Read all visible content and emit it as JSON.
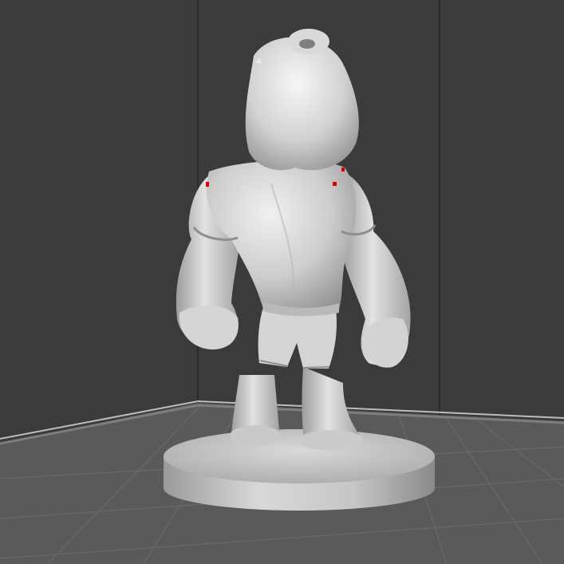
{
  "scene": {
    "subject": "figurine-back-view",
    "colors": {
      "background": "#3b3b3b",
      "floor": "#595959",
      "grid": "#6e6e6e",
      "model": "#cfcfcf",
      "model_shadow": "#8d8d8d",
      "model_highlight": "#f2f2f2",
      "error_marks": "#e00000"
    }
  }
}
